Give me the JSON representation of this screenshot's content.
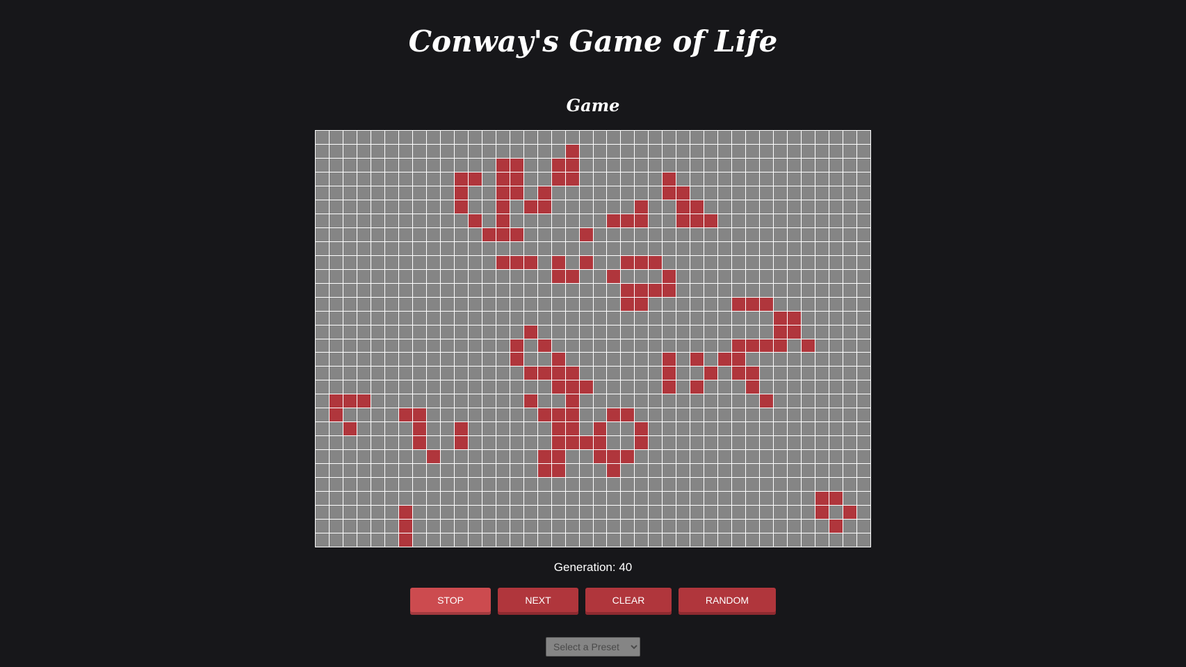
{
  "app": {
    "title": "Conway's Game of Life",
    "subtitle": "Game"
  },
  "board": {
    "cols": 40,
    "rows": 30,
    "live_color": "#b0363c",
    "dead_color": "#858585",
    "grid_color": "#ffffff",
    "live_cells": [
      [
        1,
        18
      ],
      [
        2,
        13
      ],
      [
        2,
        14
      ],
      [
        2,
        17
      ],
      [
        2,
        18
      ],
      [
        3,
        10
      ],
      [
        3,
        11
      ],
      [
        3,
        13
      ],
      [
        3,
        14
      ],
      [
        3,
        17
      ],
      [
        3,
        18
      ],
      [
        3,
        25
      ],
      [
        4,
        10
      ],
      [
        4,
        13
      ],
      [
        4,
        14
      ],
      [
        4,
        16
      ],
      [
        4,
        25
      ],
      [
        4,
        26
      ],
      [
        5,
        10
      ],
      [
        5,
        13
      ],
      [
        5,
        15
      ],
      [
        5,
        16
      ],
      [
        5,
        23
      ],
      [
        5,
        26
      ],
      [
        5,
        27
      ],
      [
        6,
        11
      ],
      [
        6,
        13
      ],
      [
        6,
        21
      ],
      [
        6,
        22
      ],
      [
        6,
        23
      ],
      [
        6,
        26
      ],
      [
        6,
        27
      ],
      [
        6,
        28
      ],
      [
        7,
        12
      ],
      [
        7,
        13
      ],
      [
        7,
        14
      ],
      [
        7,
        19
      ],
      [
        9,
        13
      ],
      [
        9,
        14
      ],
      [
        9,
        15
      ],
      [
        9,
        17
      ],
      [
        9,
        19
      ],
      [
        9,
        22
      ],
      [
        9,
        23
      ],
      [
        9,
        24
      ],
      [
        10,
        17
      ],
      [
        10,
        18
      ],
      [
        10,
        21
      ],
      [
        10,
        25
      ],
      [
        11,
        22
      ],
      [
        11,
        23
      ],
      [
        11,
        24
      ],
      [
        11,
        25
      ],
      [
        12,
        22
      ],
      [
        12,
        23
      ],
      [
        12,
        30
      ],
      [
        12,
        31
      ],
      [
        12,
        32
      ],
      [
        13,
        33
      ],
      [
        13,
        34
      ],
      [
        14,
        15
      ],
      [
        14,
        33
      ],
      [
        14,
        34
      ],
      [
        15,
        14
      ],
      [
        15,
        16
      ],
      [
        15,
        30
      ],
      [
        15,
        31
      ],
      [
        15,
        32
      ],
      [
        15,
        33
      ],
      [
        15,
        35
      ],
      [
        16,
        14
      ],
      [
        16,
        17
      ],
      [
        16,
        25
      ],
      [
        16,
        27
      ],
      [
        16,
        29
      ],
      [
        16,
        30
      ],
      [
        17,
        15
      ],
      [
        17,
        16
      ],
      [
        17,
        17
      ],
      [
        17,
        18
      ],
      [
        17,
        25
      ],
      [
        17,
        28
      ],
      [
        17,
        30
      ],
      [
        17,
        31
      ],
      [
        18,
        17
      ],
      [
        18,
        18
      ],
      [
        18,
        19
      ],
      [
        18,
        25
      ],
      [
        18,
        27
      ],
      [
        18,
        31
      ],
      [
        19,
        1
      ],
      [
        19,
        2
      ],
      [
        19,
        3
      ],
      [
        19,
        15
      ],
      [
        19,
        18
      ],
      [
        19,
        32
      ],
      [
        20,
        1
      ],
      [
        20,
        6
      ],
      [
        20,
        7
      ],
      [
        20,
        16
      ],
      [
        20,
        17
      ],
      [
        20,
        18
      ],
      [
        20,
        21
      ],
      [
        20,
        22
      ],
      [
        21,
        2
      ],
      [
        21,
        7
      ],
      [
        21,
        10
      ],
      [
        21,
        17
      ],
      [
        21,
        18
      ],
      [
        21,
        20
      ],
      [
        21,
        23
      ],
      [
        22,
        7
      ],
      [
        22,
        10
      ],
      [
        22,
        17
      ],
      [
        22,
        18
      ],
      [
        22,
        19
      ],
      [
        22,
        20
      ],
      [
        22,
        23
      ],
      [
        23,
        8
      ],
      [
        23,
        16
      ],
      [
        23,
        17
      ],
      [
        23,
        20
      ],
      [
        23,
        21
      ],
      [
        23,
        22
      ],
      [
        24,
        16
      ],
      [
        24,
        17
      ],
      [
        24,
        21
      ],
      [
        26,
        36
      ],
      [
        26,
        37
      ],
      [
        27,
        6
      ],
      [
        27,
        36
      ],
      [
        27,
        38
      ],
      [
        28,
        6
      ],
      [
        28,
        37
      ],
      [
        29,
        6
      ]
    ]
  },
  "status": {
    "generation": "Generation: 40"
  },
  "controls": {
    "stop_label": "STOP",
    "next_label": "NEXT",
    "clear_label": "CLEAR",
    "random_label": "RANDOM"
  },
  "preset": {
    "selected": "Select a Preset"
  }
}
